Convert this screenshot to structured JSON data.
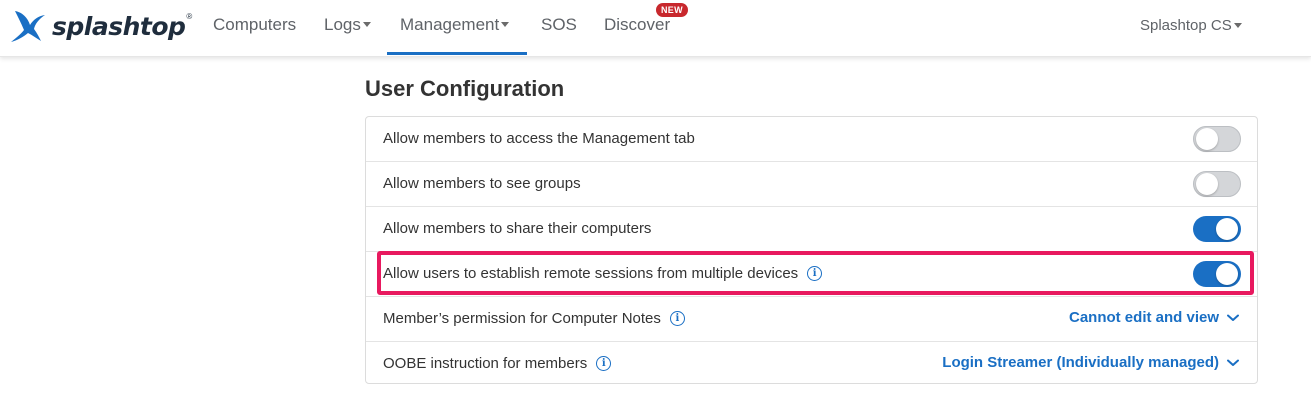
{
  "brand": {
    "name": "splashtop",
    "trademark": "®",
    "color": "#1f2d3d",
    "accent": "#1a6fc4"
  },
  "nav": {
    "items": [
      {
        "label": "Computers"
      },
      {
        "label": "Logs"
      },
      {
        "label": "Management"
      },
      {
        "label": "SOS"
      },
      {
        "label": "Discover"
      }
    ],
    "active": "Management",
    "new_badge": "NEW",
    "account": "Splashtop CS"
  },
  "section": {
    "title": "User Configuration"
  },
  "settings": [
    {
      "label": "Allow members to access the Management tab",
      "type": "toggle",
      "enabled": false
    },
    {
      "label": "Allow members to see groups",
      "type": "toggle",
      "enabled": false
    },
    {
      "label": "Allow members to share their computers",
      "type": "toggle",
      "enabled": true
    },
    {
      "label": "Allow users to establish remote sessions from multiple devices",
      "type": "toggle",
      "enabled": true,
      "info": true,
      "highlighted": true
    },
    {
      "label": "Member’s permission for Computer Notes",
      "type": "select",
      "value": "Cannot edit and view",
      "info": true
    },
    {
      "label": "OOBE instruction for members",
      "type": "select",
      "value": "Login Streamer (Individually managed)",
      "info": true
    }
  ],
  "colors": {
    "toggle_on": "#1a6fc4",
    "toggle_off": "#d4d6d9",
    "highlight": "#e8195f",
    "new_badge": "#c8282d"
  },
  "icons": {
    "info": "info-icon",
    "dropdown": "chevron-down-icon"
  }
}
